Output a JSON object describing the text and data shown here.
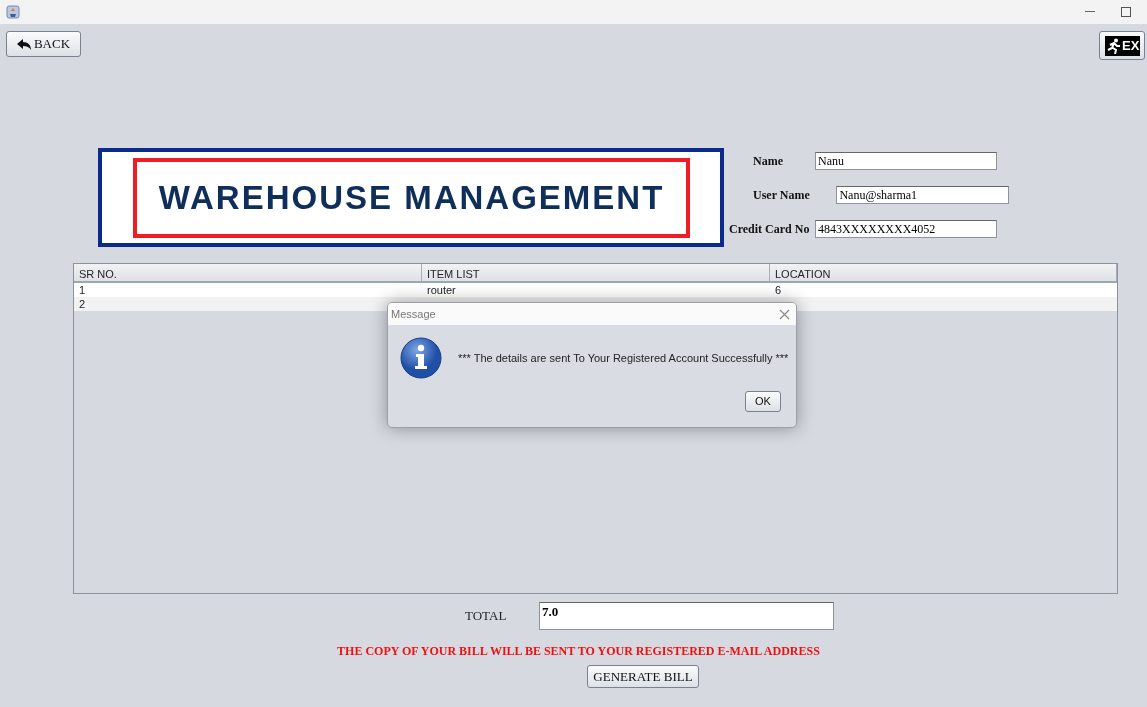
{
  "toolbar": {
    "back_button": "BACK",
    "exit_button": "EX"
  },
  "logo": {
    "title": "WAREHOUSE MANAGEMENT"
  },
  "fields": [
    {
      "label": "Name",
      "value": "Nanu"
    },
    {
      "label": "User Name",
      "value": "Nanu@sharma1"
    },
    {
      "label": "Credit Card No",
      "value": "4843XXXXXXXX4052"
    }
  ],
  "table": {
    "columns": [
      "SR NO.",
      "ITEM LIST",
      "LOCATION"
    ],
    "rows": [
      [
        "1",
        "router",
        "6"
      ],
      [
        "2"
      ]
    ]
  },
  "total": {
    "label": "TOTAL",
    "value": "7.0"
  },
  "notice": "THE COPY OF YOUR BILL WILL BE SENT TO YOUR REGISTERED E-MAIL ADDRESS",
  "generate_button": "GENERATE BILL",
  "dialog": {
    "title": "Message",
    "message": "*** The details are sent To Your Registered Account Successfully ***",
    "ok_button": "OK"
  }
}
